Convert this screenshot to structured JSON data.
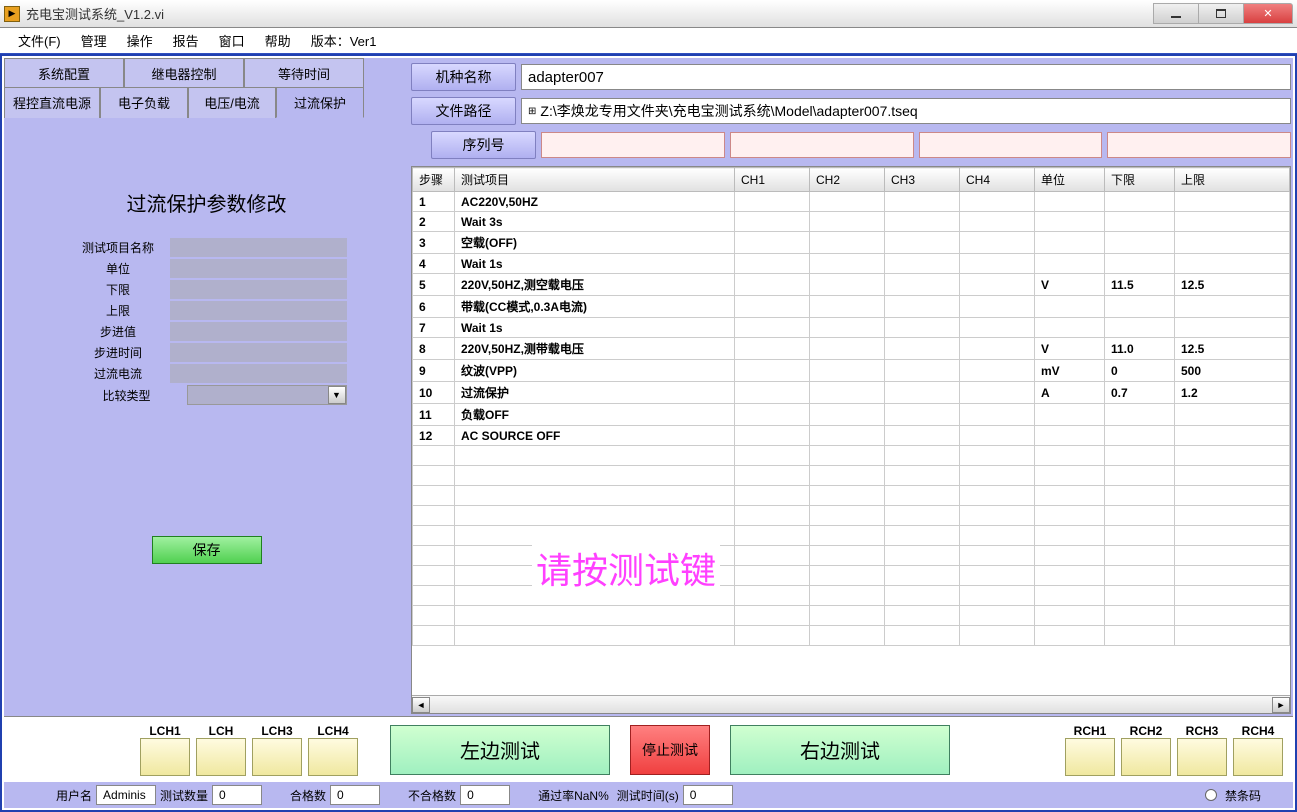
{
  "window": {
    "title": "充电宝测试系统_V1.2.vi"
  },
  "menu": {
    "file": "文件(F)",
    "manage": "管理",
    "operate": "操作",
    "report": "报告",
    "window": "窗口",
    "help": "帮助",
    "version": "版本：Ver1"
  },
  "tabs_top": {
    "sys_config": "系统配置",
    "relay_ctrl": "继电器控制",
    "wait_time": "等待时间"
  },
  "tabs_bottom": {
    "prog_power": "程控直流电源",
    "eload": "电子负载",
    "vi": "电压/电流",
    "ocp": "过流保护"
  },
  "config": {
    "title": "过流保护参数修改",
    "labels": {
      "item_name": "测试项目名称",
      "unit": "单位",
      "lower": "下限",
      "upper": "上限",
      "step_val": "步进值",
      "step_time": "步进时间",
      "oc_current": "过流电流",
      "compare_type": "比较类型"
    },
    "save": "保存"
  },
  "header": {
    "model_label": "机种名称",
    "model_value": "adapter007",
    "path_label": "文件路径",
    "path_value": "Z:\\李焕龙专用文件夹\\充电宝测试系统\\Model\\adapter007.tseq",
    "serial_label": "序列号"
  },
  "table": {
    "columns": {
      "step": "步骤",
      "item": "测试项目",
      "ch1": "CH1",
      "ch2": "CH2",
      "ch3": "CH3",
      "ch4": "CH4",
      "unit": "单位",
      "lower": "下限",
      "upper": "上限"
    },
    "rows": [
      {
        "n": "1",
        "item": "AC220V,50HZ",
        "unit": "",
        "lo": "",
        "hi": ""
      },
      {
        "n": "2",
        "item": "Wait 3s",
        "unit": "",
        "lo": "",
        "hi": ""
      },
      {
        "n": "3",
        "item": "空载(OFF)",
        "unit": "",
        "lo": "",
        "hi": ""
      },
      {
        "n": "4",
        "item": "Wait  1s",
        "unit": "",
        "lo": "",
        "hi": ""
      },
      {
        "n": "5",
        "item": "220V,50HZ,测空载电压",
        "unit": "V",
        "lo": "11.5",
        "hi": "12.5"
      },
      {
        "n": "6",
        "item": "带载(CC模式,0.3A电流)",
        "unit": "",
        "lo": "",
        "hi": ""
      },
      {
        "n": "7",
        "item": "Wait 1s",
        "unit": "",
        "lo": "",
        "hi": ""
      },
      {
        "n": "8",
        "item": "220V,50HZ,测带载电压",
        "unit": "V",
        "lo": "11.0",
        "hi": "12.5"
      },
      {
        "n": "9",
        "item": "纹波(VPP)",
        "unit": "mV",
        "lo": "0",
        "hi": "500"
      },
      {
        "n": "10",
        "item": "过流保护",
        "unit": "A",
        "lo": "0.7",
        "hi": "1.2"
      },
      {
        "n": "11",
        "item": "负载OFF",
        "unit": "",
        "lo": "",
        "hi": ""
      },
      {
        "n": "12",
        "item": "AC SOURCE OFF",
        "unit": "",
        "lo": "",
        "hi": ""
      }
    ],
    "overlay": "请按测试键"
  },
  "buttons": {
    "lch": [
      "LCH1",
      "LCH",
      "LCH3",
      "LCH4"
    ],
    "rch": [
      "RCH1",
      "RCH2",
      "RCH3",
      "RCH4"
    ],
    "left_test": "左边测试",
    "stop_test": "停止测试",
    "right_test": "右边测试"
  },
  "status": {
    "user_label": "用户名",
    "user_value": "Adminis",
    "test_count_label": "测试数量",
    "test_count_value": "0",
    "pass_label": "合格数",
    "pass_value": "0",
    "fail_label": "不合格数",
    "fail_value": "0",
    "rate_label": "通过率NaN%",
    "time_label": "测试时间(s)",
    "time_value": "0",
    "no_barcode": "禁条码"
  }
}
